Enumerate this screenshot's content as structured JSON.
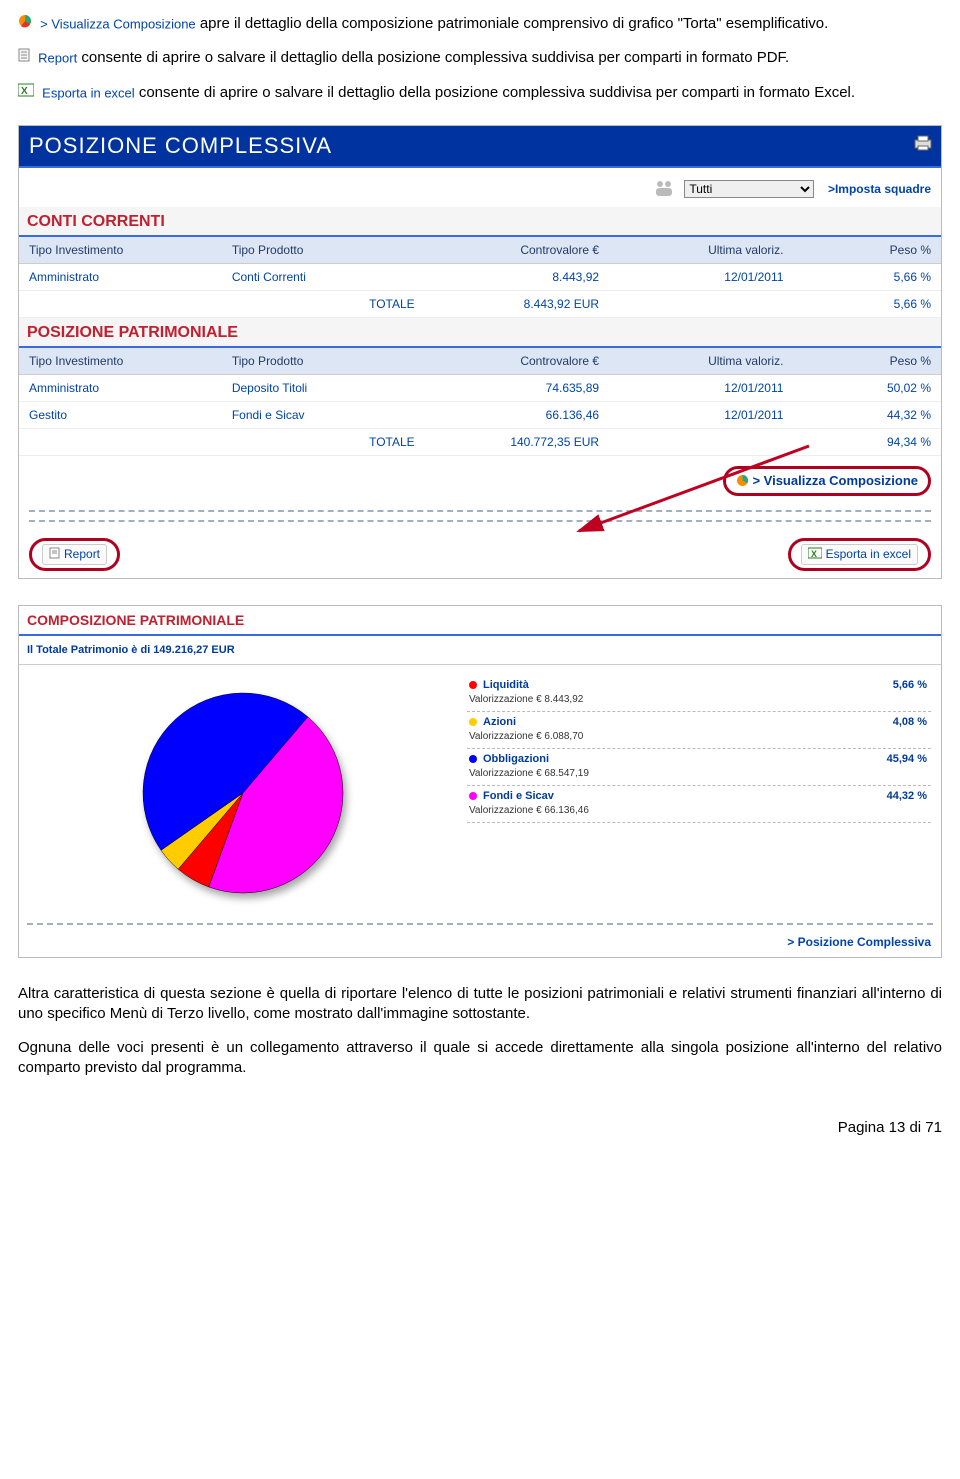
{
  "intro": {
    "vc_label": "> Visualizza Composizione",
    "vc_body": " apre il dettaglio della composizione patrimoniale comprensivo di grafico \"Torta\" esemplificativo.",
    "report_label": "Report",
    "report_body": " consente di aprire o salvare il dettaglio della posizione complessiva suddivisa per comparti in formato PDF.",
    "excel_label": "Esporta in excel",
    "excel_body": " consente di aprire o salvare il dettaglio della posizione complessiva suddivisa per comparti in formato Excel."
  },
  "panel": {
    "title": "POSIZIONE COMPLESSIVA",
    "squad_selected": "Tutti",
    "squad_link": ">Imposta squadre",
    "sections": {
      "conti": {
        "title": "CONTI CORRENTI",
        "headers": [
          "Tipo Investimento",
          "Tipo Prodotto",
          "Controvalore €",
          "Ultima valoriz.",
          "Peso %"
        ],
        "rows": [
          {
            "tipo_inv": "Amministrato",
            "tipo_prod": "Conti Correnti",
            "cv": "8.443,92",
            "uv": "12/01/2011",
            "peso": "5,66 %"
          }
        ],
        "totale_label": "TOTALE",
        "totale_cv": "8.443,92  EUR",
        "totale_peso": "5,66 %"
      },
      "patr": {
        "title": "POSIZIONE PATRIMONIALE",
        "headers": [
          "Tipo Investimento",
          "Tipo Prodotto",
          "Controvalore €",
          "Ultima valoriz.",
          "Peso %"
        ],
        "rows": [
          {
            "tipo_inv": "Amministrato",
            "tipo_prod": "Deposito Titoli",
            "cv": "74.635,89",
            "uv": "12/01/2011",
            "peso": "50,02 %"
          },
          {
            "tipo_inv": "Gestito",
            "tipo_prod": "Fondi e Sicav",
            "cv": "66.136,46",
            "uv": "12/01/2011",
            "peso": "44,32 %"
          }
        ],
        "totale_label": "TOTALE",
        "totale_cv": "140.772,35  EUR",
        "totale_peso": "94,34 %"
      }
    },
    "vc_link": "> Visualizza Composizione",
    "report_btn": "Report",
    "excel_btn": "Esporta in excel"
  },
  "chart_data": {
    "type": "pie",
    "title": "COMPOSIZIONE PATRIMONIALE",
    "total_label": "Il Totale Patrimonio è di 149.216,27  EUR",
    "series": [
      {
        "name": "Liquidità",
        "pct": 5.66,
        "pct_txt": "5,66 %",
        "val": "Valorizzazione € 8.443,92",
        "color": "#ff0000"
      },
      {
        "name": "Azioni",
        "pct": 4.08,
        "pct_txt": "4,08 %",
        "val": "Valorizzazione € 6.088,70",
        "color": "#ffcc00"
      },
      {
        "name": "Obbligazioni",
        "pct": 45.94,
        "pct_txt": "45,94 %",
        "val": "Valorizzazione € 68.547,19",
        "color": "#0000ff"
      },
      {
        "name": "Fondi e Sicav",
        "pct": 44.32,
        "pct_txt": "44,32 %",
        "val": "Valorizzazione € 66.136,46",
        "color": "#ff00ff"
      }
    ],
    "back_link": "> Posizione Complessiva"
  },
  "para1": "Altra caratteristica di questa sezione è quella di riportare l'elenco di tutte le posizioni patrimoniali e relativi strumenti finanziari all'interno di uno specifico Menù di Terzo livello, come mostrato dall'immagine sottostante.",
  "para2": "Ognuna delle voci presenti è un collegamento attraverso il quale si accede direttamente alla singola posizione all'interno del relativo comparto previsto dal programma.",
  "footer": "Pagina 13 di 71"
}
